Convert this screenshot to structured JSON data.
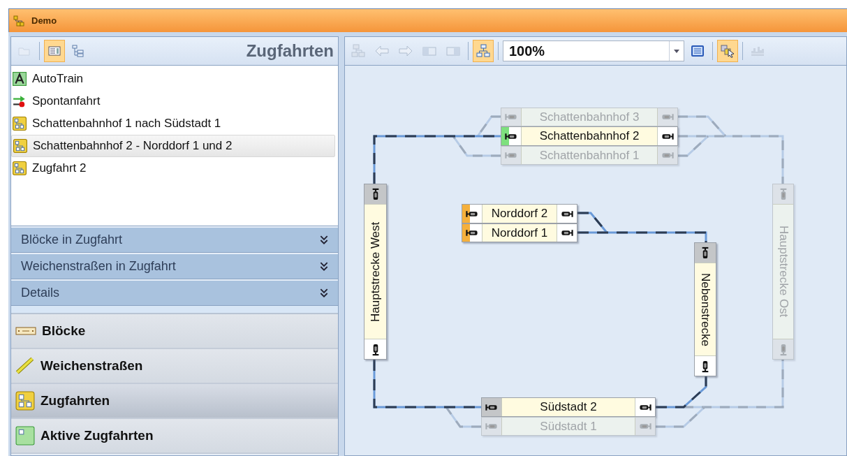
{
  "window": {
    "title": "Demo"
  },
  "left_panel": {
    "title": "Zugfahrten",
    "toolbar": [
      {
        "kind": "folder",
        "selected": false,
        "disabled": true
      },
      {
        "kind": "list",
        "selected": true,
        "disabled": false
      },
      {
        "kind": "tree",
        "selected": false,
        "disabled": false
      }
    ],
    "items": [
      {
        "label": "AutoTrain",
        "kind": "autotrain",
        "selected": false
      },
      {
        "label": "Spontanfahrt",
        "kind": "spontaneous",
        "selected": false
      },
      {
        "label": "Schattenbahnhof 1 nach Südstadt 1",
        "kind": "route",
        "selected": false
      },
      {
        "label": "Schattenbahnhof 2 - Norddorf 1 und 2",
        "kind": "route",
        "selected": true
      },
      {
        "label": "Zugfahrt 2",
        "kind": "route",
        "selected": false
      }
    ],
    "sections": [
      {
        "label": "Blöcke in Zugfahrt",
        "expanded": false
      },
      {
        "label": "Weichenstraßen in Zugfahrt",
        "expanded": false
      },
      {
        "label": "Details",
        "expanded": false
      }
    ],
    "nav": [
      {
        "label": "Blöcke",
        "kind": "blocks",
        "selected": false
      },
      {
        "label": "Weichenstraßen",
        "kind": "switches",
        "selected": false
      },
      {
        "label": "Zugfahrten",
        "kind": "routes",
        "selected": true
      },
      {
        "label": "Aktive Zugfahrten",
        "kind": "active",
        "selected": false
      }
    ]
  },
  "canvas_toolbar": {
    "buttons_left": [
      {
        "kind": "diagram",
        "selected": false,
        "disabled": true
      },
      {
        "kind": "back",
        "selected": false,
        "disabled": true
      },
      {
        "kind": "forward",
        "selected": false,
        "disabled": true
      },
      {
        "kind": "rect-left",
        "selected": false,
        "disabled": true
      },
      {
        "kind": "rect-right",
        "selected": false,
        "disabled": true
      },
      {
        "kind": "layout",
        "selected": true,
        "disabled": false
      }
    ],
    "zoom": "100%",
    "buttons_right": [
      {
        "kind": "screen",
        "selected": false,
        "disabled": false
      },
      {
        "kind": "pointer",
        "selected": true,
        "disabled": false
      },
      {
        "kind": "chart",
        "selected": false,
        "disabled": true
      }
    ]
  },
  "blocks": [
    {
      "name": "Schattenbahnhof 3",
      "kind": "horizontal",
      "active": false
    },
    {
      "name": "Schattenbahnhof 2",
      "kind": "horizontal",
      "active": true,
      "color": "#7ee07e"
    },
    {
      "name": "Schattenbahnhof 1",
      "kind": "horizontal",
      "active": false
    },
    {
      "name": "Hauptstrecke West",
      "kind": "up",
      "active": true
    },
    {
      "name": "Norddorf 2",
      "kind": "horizontal",
      "active": true,
      "color": "#f5b03c"
    },
    {
      "name": "Norddorf 1",
      "kind": "horizontal",
      "active": true,
      "color": "#f5b03c"
    },
    {
      "name": "Nebenstrecke",
      "kind": "down",
      "active": true
    },
    {
      "name": "Hauptstrecke Ost",
      "kind": "down",
      "active": false
    },
    {
      "name": "Südstadt 2",
      "kind": "horizontal",
      "active": true
    },
    {
      "name": "Südstadt 1",
      "kind": "horizontal",
      "active": false
    }
  ]
}
